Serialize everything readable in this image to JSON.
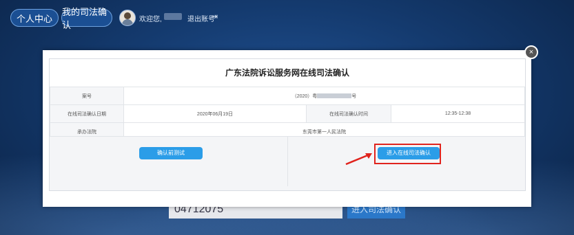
{
  "nav": {
    "personal_center": "个人中心",
    "my_confirmation": "我的司法确认",
    "welcome": "欢迎您,",
    "logout": "退出账号",
    "logout_icon": "logout-icon"
  },
  "background": {
    "code_partial": "04712075",
    "enter_btn_partial": "进入司法确认"
  },
  "modal": {
    "close_icon": "×",
    "title": "广东法院诉讼服务网在线司法确认",
    "rows": [
      {
        "label": "案号",
        "value": "（2020）粤",
        "value_suffix": "号"
      },
      {
        "label": "在线司法确认日期",
        "value": "2020年06月19日",
        "label2": "在线司法确认时间",
        "value2": "12:35-12:38"
      },
      {
        "label": "承办法院",
        "value": "东莞市第一人民法院"
      }
    ],
    "test_button": "确认前测试",
    "enter_button": "进入在线司法确认"
  },
  "colors": {
    "accent": "#2b9de8",
    "highlight": "#e0231d",
    "bg_dark": "#0b2346"
  }
}
